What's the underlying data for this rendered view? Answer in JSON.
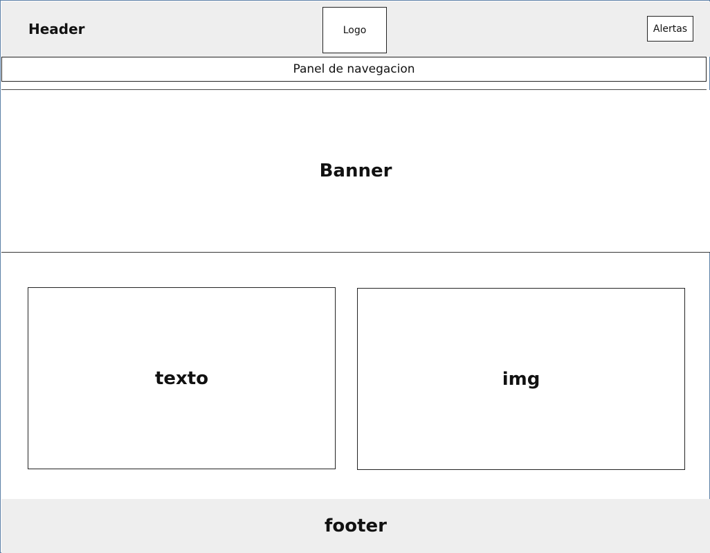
{
  "header": {
    "title": "Header",
    "logo_label": "Logo",
    "alerts_label": "Alertas"
  },
  "nav": {
    "label": "Panel de navegacion"
  },
  "banner": {
    "label": "Banner"
  },
  "content": {
    "text_label": "texto",
    "image_label": "img"
  },
  "footer": {
    "label": "footer"
  },
  "colors": {
    "header_bg": "#eeeeee",
    "footer_bg": "#eeeeee",
    "frame_border": "#5b7fa6",
    "line": "#222222"
  }
}
